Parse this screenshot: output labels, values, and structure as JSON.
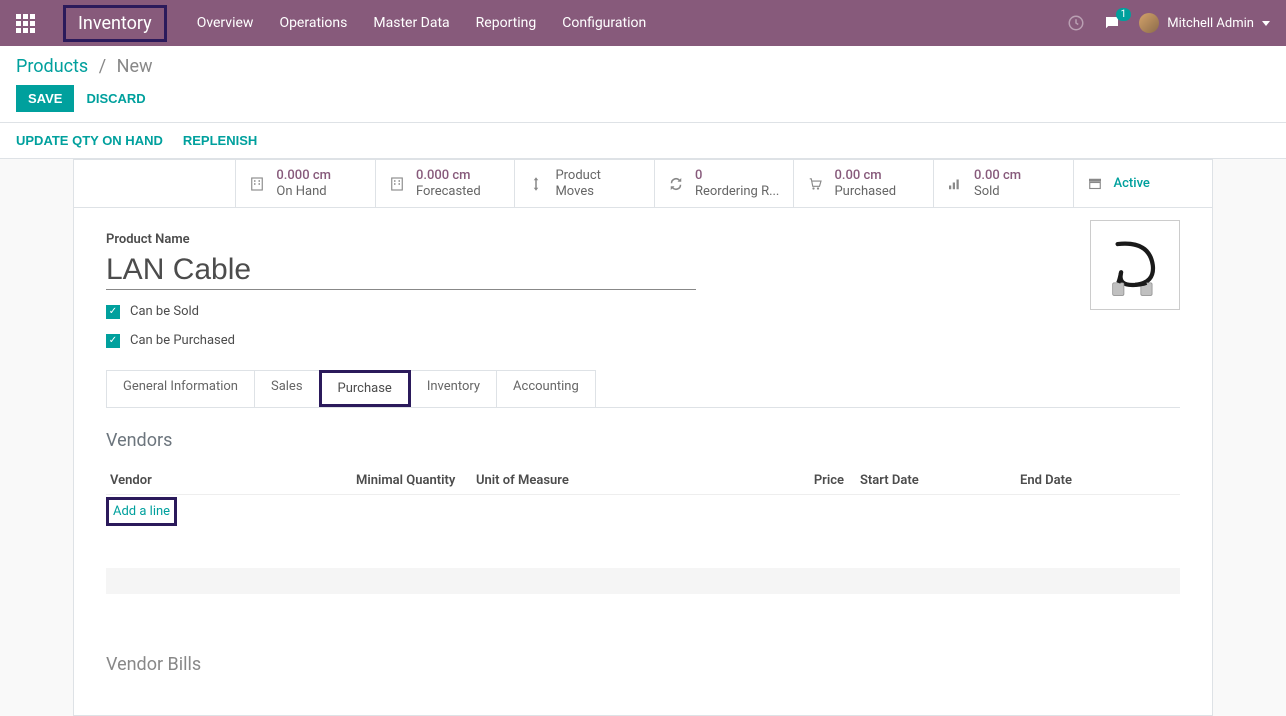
{
  "navbar": {
    "brand": "Inventory",
    "menu": [
      "Overview",
      "Operations",
      "Master Data",
      "Reporting",
      "Configuration"
    ],
    "msg_count": "1",
    "user_name": "Mitchell Admin"
  },
  "breadcrumb": {
    "root": "Products",
    "current": "New"
  },
  "buttons": {
    "save": "SAVE",
    "discard": "DISCARD",
    "update_qty": "UPDATE QTY ON HAND",
    "replenish": "REPLENISH"
  },
  "stats": {
    "on_hand_val": "0.000 cm",
    "on_hand_label": "On Hand",
    "forecast_val": "0.000 cm",
    "forecast_label": "Forecasted",
    "moves_label1": "Product",
    "moves_label2": "Moves",
    "reorder_val": "0",
    "reorder_label": "Reordering R...",
    "purchased_val": "0.00 cm",
    "purchased_label": "Purchased",
    "sold_val": "0.00 cm",
    "sold_label": "Sold",
    "active": "Active"
  },
  "product": {
    "name_label": "Product Name",
    "name": "LAN Cable",
    "can_sold": "Can be Sold",
    "can_purchased": "Can be Purchased"
  },
  "tabs": [
    "General Information",
    "Sales",
    "Purchase",
    "Inventory",
    "Accounting"
  ],
  "vendors": {
    "title": "Vendors",
    "cols": {
      "vendor": "Vendor",
      "minqty": "Minimal Quantity",
      "uom": "Unit of Measure",
      "price": "Price",
      "start": "Start Date",
      "end": "End Date"
    },
    "add_line": "Add a line",
    "next_section": "Vendor Bills"
  }
}
